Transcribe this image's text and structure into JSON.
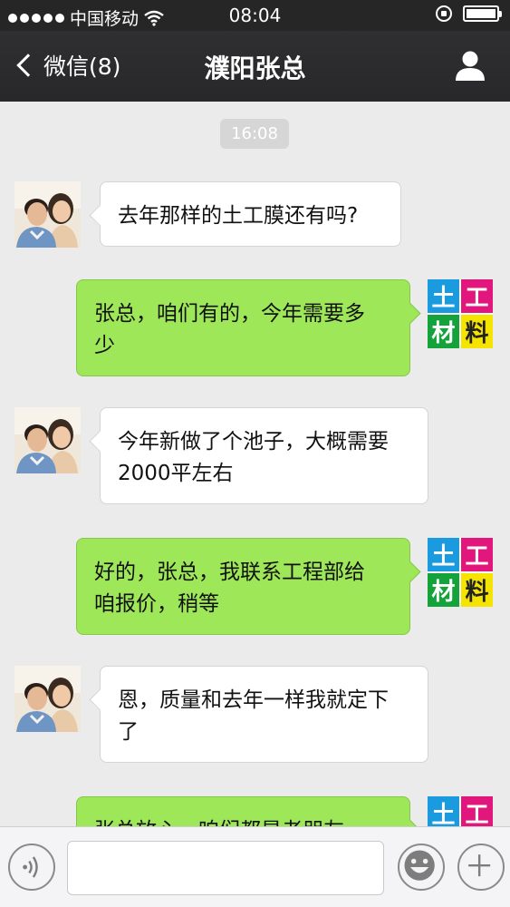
{
  "status_bar": {
    "carrier": "中国移动",
    "time": "08:04",
    "icons": [
      "signal-dots-icon",
      "wifi-icon",
      "rotation-lock-icon",
      "battery-icon"
    ],
    "battery_level": 1.0
  },
  "nav": {
    "back_label": "微信(8)",
    "title": "濮阳张总",
    "icons": [
      "chevron-left-icon",
      "person-icon"
    ]
  },
  "chat": {
    "timestamp": "16:08",
    "contact_avatar": "couple-photo-avatar",
    "own_avatar": {
      "name": "tugong-cailiao-logo",
      "chars": [
        "土",
        "工",
        "材",
        "料"
      ],
      "colors": [
        "#1a9be0",
        "#e2177d",
        "#14a33b",
        "#f5e400"
      ]
    },
    "messages": [
      {
        "from": "contact",
        "lines": [
          "去年那样的土工膜还有吗?"
        ]
      },
      {
        "from": "me",
        "lines": [
          "张总，咱们有的，今年需要多",
          "少"
        ]
      },
      {
        "from": "contact",
        "lines": [
          "今年新做了个池子，大概需要",
          "2000平左右"
        ]
      },
      {
        "from": "me",
        "lines": [
          "好的，张总，我联系工程部给",
          "咱报价，稍等"
        ]
      },
      {
        "from": "contact",
        "lines": [
          "恩，质量和去年一样我就定下",
          "了"
        ]
      },
      {
        "from": "me",
        "lines": [
          "张总放心，咱们都是老朋友"
        ]
      }
    ]
  },
  "input_bar": {
    "text_value": "",
    "icons": [
      "voice-icon",
      "emoji-icon",
      "plus-icon"
    ]
  },
  "colors": {
    "outgoing_bubble": "#9ee758",
    "incoming_bubble": "#ffffff",
    "chat_background": "#ebebeb",
    "nav_background": "#2f2f31"
  }
}
